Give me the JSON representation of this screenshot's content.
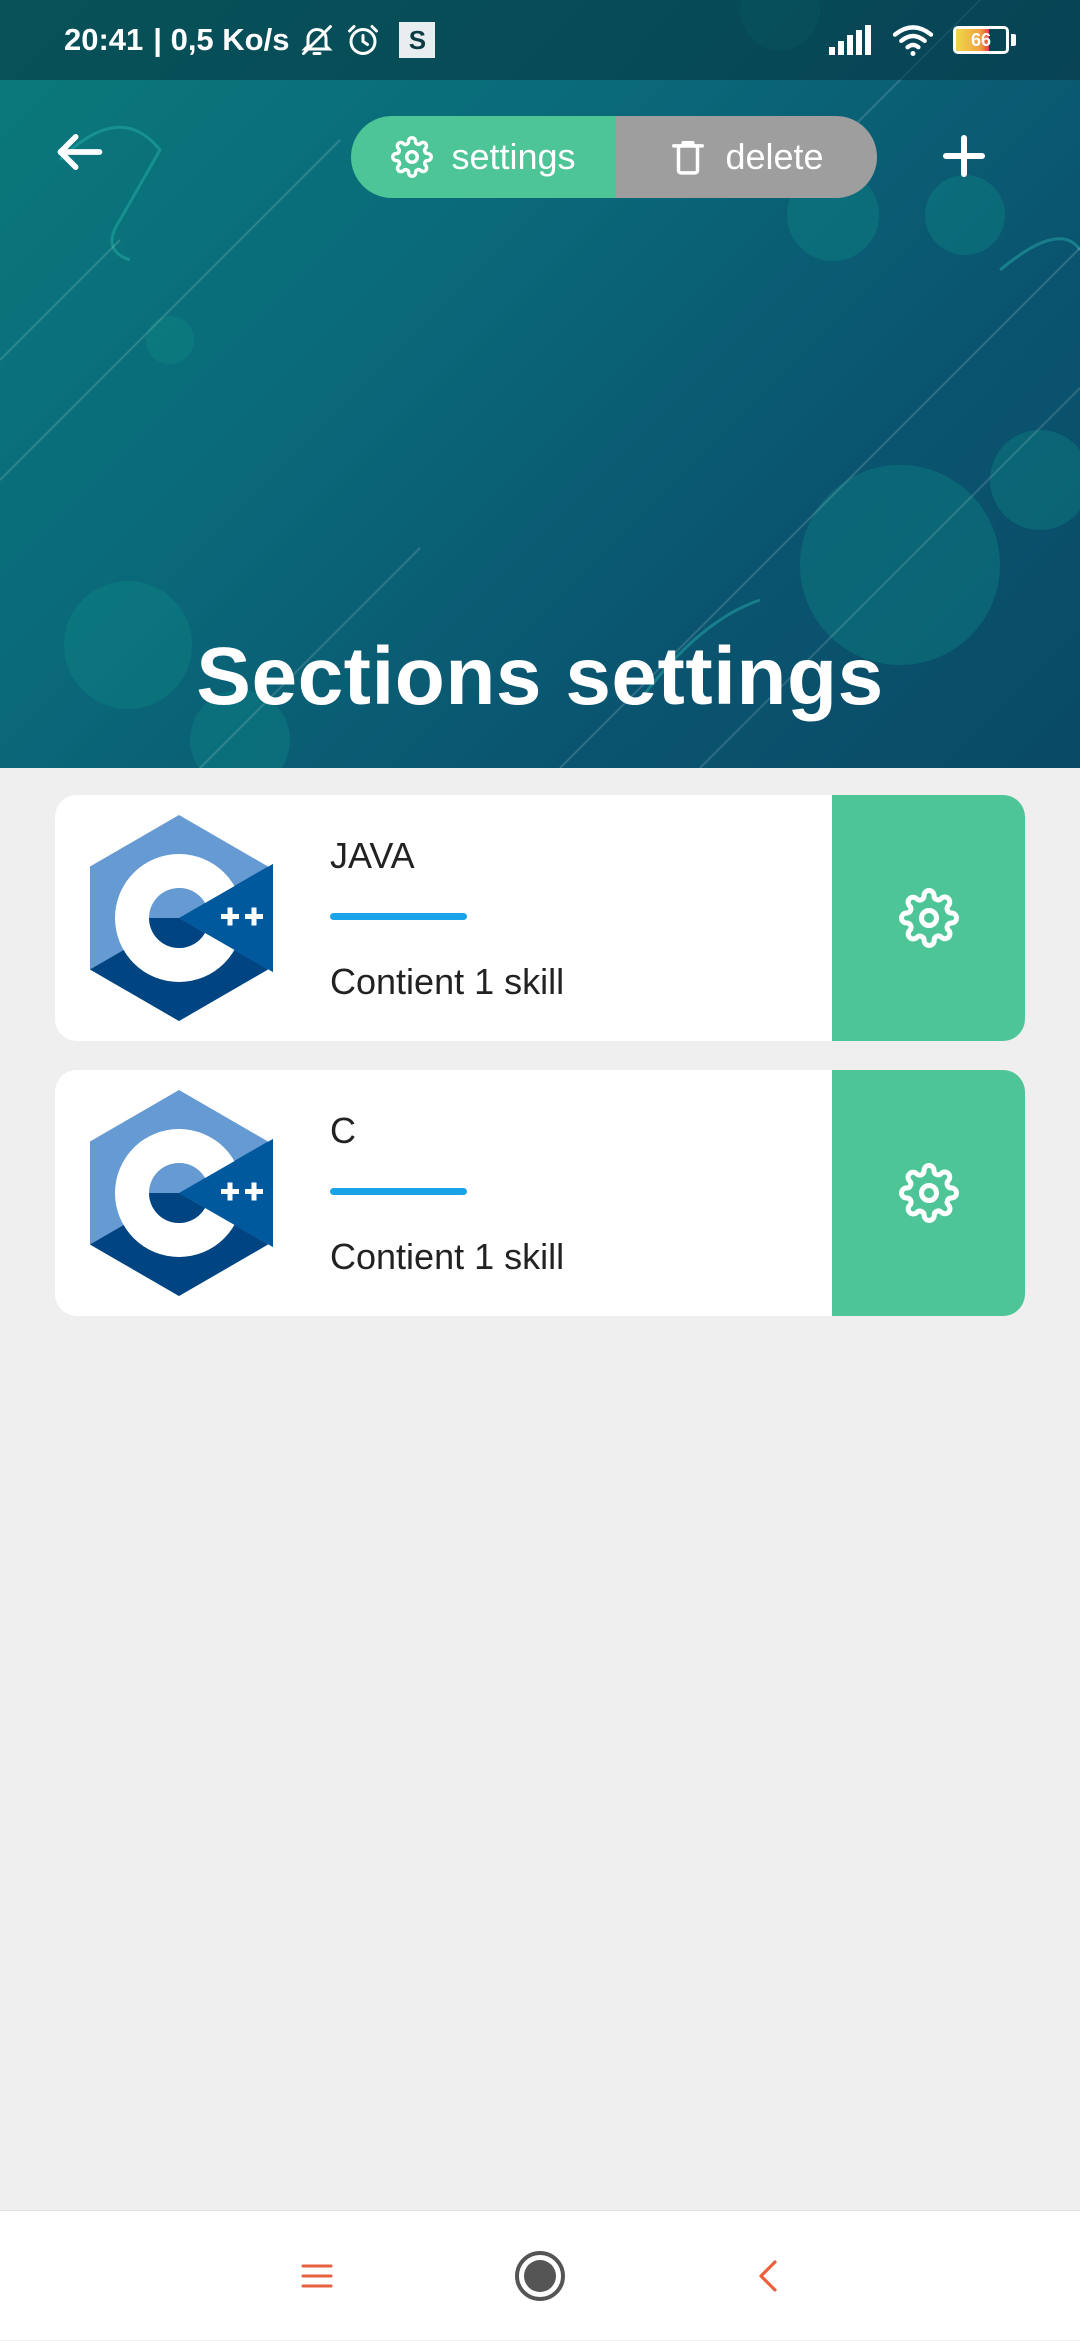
{
  "status_bar": {
    "time": "20:41",
    "network_speed": "| 0,5 Ko/s",
    "app_badge": "S",
    "battery_level": "66",
    "battery_fraction": 0.66,
    "icons": [
      "muted-bell-icon",
      "alarm-icon",
      "signal-icon",
      "wifi-icon",
      "battery-icon"
    ]
  },
  "header": {
    "title": "Sections settings",
    "segmented": {
      "settings_label": "settings",
      "delete_label": "delete",
      "settings_icon": "gear-icon",
      "delete_icon": "trash-icon"
    },
    "back_icon": "arrow-left-icon",
    "add_icon": "plus-icon"
  },
  "sections": [
    {
      "title": "JAVA",
      "subtitle": "Contient 1 skill",
      "logo": "cpp-logo",
      "action_icon": "gear-icon"
    },
    {
      "title": "C",
      "subtitle": "Contient 1 skill",
      "logo": "cpp-logo",
      "action_icon": "gear-icon"
    }
  ],
  "nav_bar": {
    "items": [
      "menu-icon",
      "home-icon",
      "back-chevron-icon"
    ]
  },
  "colors": {
    "accent_green": "#4ec596",
    "delete_gray": "#9e9e9e",
    "progress_blue": "#1aa3e8",
    "header_teal": "#0a6b7a",
    "nav_icon_orange": "#e8603c",
    "background": "#efefef"
  }
}
